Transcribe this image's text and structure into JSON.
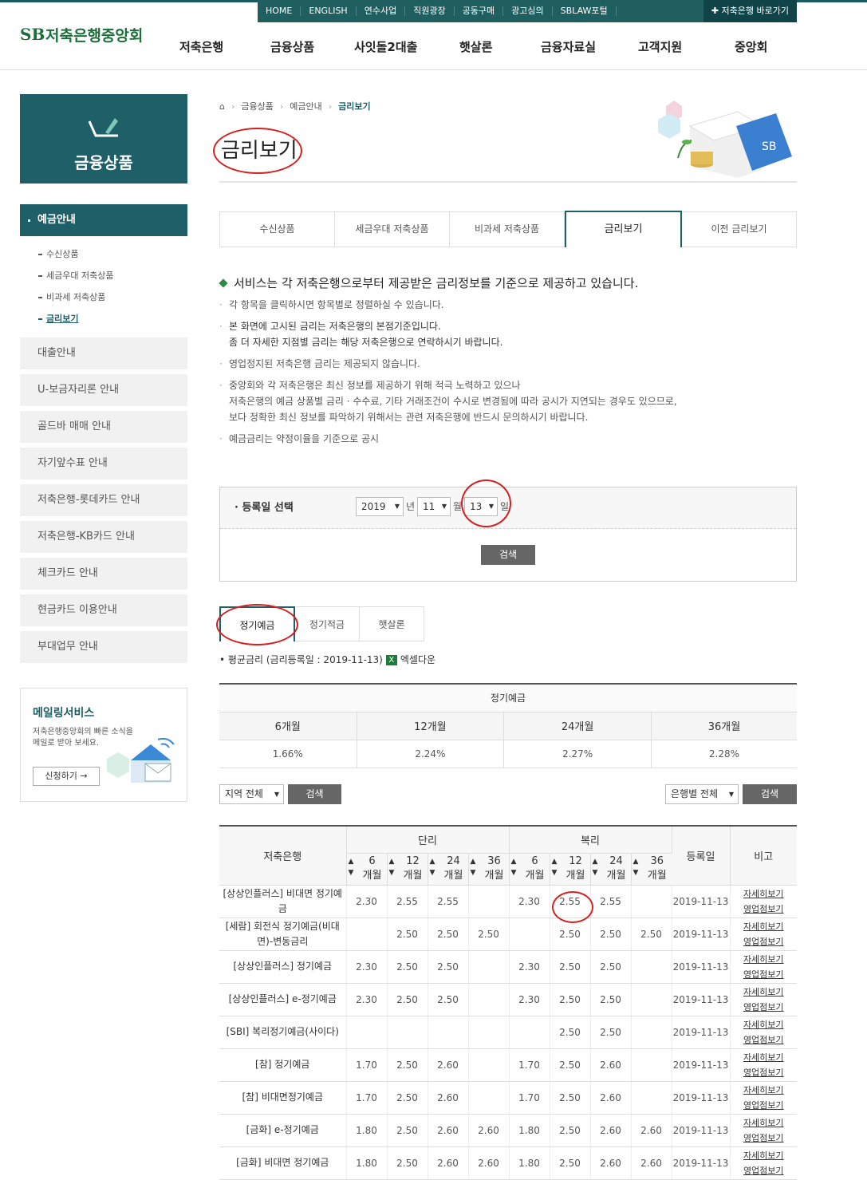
{
  "util": [
    "HOME",
    "ENGLISH",
    "연수사업",
    "직원광장",
    "공동구매",
    "광고심의",
    "SBLAW포털",
    "✚ 저축은행 바로가기"
  ],
  "logo": {
    "mark": "SB",
    "text": "저축은행중앙회"
  },
  "gnb": [
    "저축은행",
    "금융상품",
    "사잇돌2대출",
    "햇살론",
    "금융자료실",
    "고객지원",
    "중앙회"
  ],
  "lnb": {
    "title": "금융상품",
    "active": "예금안내",
    "subs": [
      "수신상품",
      "세금우대 저축상품",
      "비과세 저축상품",
      "금리보기"
    ],
    "items": [
      "대출안내",
      "U-보금자리론 안내",
      "골드바 매매 안내",
      "자기앞수표 안내",
      "저축은행-롯데카드 안내",
      "저축은행-KB카드 안내",
      "체크카드 안내",
      "현금카드 이용안내",
      "부대업무 안내"
    ]
  },
  "mail": {
    "title": "메일링서비스",
    "desc": "저축은행중앙회의 빠른 소식을\n메일로 받아 보세요.",
    "btn": "신청하기 →"
  },
  "crumb": [
    "금융상품",
    "예금안내",
    "금리보기"
  ],
  "page_title": "금리보기",
  "tabs": [
    "수신상품",
    "세금우대 저축상품",
    "비과세 저축상품",
    "금리보기",
    "이전 금리보기"
  ],
  "notice": "서비스는 각 저축은행으로부터 제공받은 금리정보를 기준으로 제공하고 있습니다.",
  "bullets": [
    "각 항목을 클릭하시면 항목별로 정렬하실 수 있습니다.",
    "본 화면에 고시된 금리는 저축은행의 본점기준입니다.\n좀 더 자세한 지점별 금리는 해당 저축은행으로 연락하시기 바랍니다.",
    "영업정지된 저축은행 금리는 제공되지 않습니다.",
    "중앙회와 각 저축은행은 최신 정보를 제공하기 위해 적극 노력하고 있으나\n저축은행의 예금 상품별 금리 · 수수료, 기타 거래조건이 수시로 변경됨에 따라 공시가 지연되는 경우도 있으므로,\n보다 정확한 최신 정보를 파악하기 위해서는 관련 저축은행에 반드시 문의하시기 바랍니다.",
    "예금금리는 약정이율을 기준으로 공시"
  ],
  "reg": {
    "label": "등록일 선택",
    "year": "2019",
    "month": "11",
    "day": "13",
    "u_year": "년",
    "u_month": "월",
    "u_day": "일",
    "search": "검색"
  },
  "subtabs": [
    "정기예금",
    "정기적금",
    "햇살론"
  ],
  "avg": {
    "text": "평균금리 (금리등록일 : 2019-11-13)",
    "excel": "엑셀다운",
    "head": "정기예금",
    "cols": [
      "6개월",
      "12개월",
      "24개월",
      "36개월"
    ],
    "vals": [
      "1.66%",
      "2.24%",
      "2.27%",
      "2.28%"
    ]
  },
  "filters": {
    "region": "지역 전체",
    "bank": "은행별 전체",
    "search": "검색"
  },
  "table": {
    "h_bank": "저축은행",
    "h_simple": "단리",
    "h_comp": "복리",
    "h_date": "등록일",
    "h_note": "비고",
    "periods": [
      "6",
      "12",
      "24",
      "36"
    ],
    "unit": "개월",
    "sort_up": "▲",
    "sort_down": "▼",
    "link1": "자세히보기",
    "link2": "영업점보기",
    "rows": [
      {
        "name": "[상상인플러스] 비대면 정기예금",
        "v": [
          "2.30",
          "2.55",
          "2.55",
          "",
          "2.30",
          "2.55",
          "2.55",
          ""
        ],
        "date": "2019-11-13"
      },
      {
        "name": "[세람] 회전식 정기예금(비대면)-변동금리",
        "v": [
          "",
          "2.50",
          "2.50",
          "2.50",
          "",
          "2.50",
          "2.50",
          "2.50"
        ],
        "date": "2019-11-13"
      },
      {
        "name": "[상상인플러스] 정기예금",
        "v": [
          "2.30",
          "2.50",
          "2.50",
          "",
          "2.30",
          "2.50",
          "2.50",
          ""
        ],
        "date": "2019-11-13"
      },
      {
        "name": "[상상인플러스] e-정기예금",
        "v": [
          "2.30",
          "2.50",
          "2.50",
          "",
          "2.30",
          "2.50",
          "2.50",
          ""
        ],
        "date": "2019-11-13"
      },
      {
        "name": "[SBI] 복리정기예금(사이다)",
        "v": [
          "",
          "",
          "",
          "",
          "",
          "2.50",
          "2.50",
          ""
        ],
        "date": "2019-11-13"
      },
      {
        "name": "[참] 정기예금",
        "v": [
          "1.70",
          "2.50",
          "2.60",
          "",
          "1.70",
          "2.50",
          "2.60",
          ""
        ],
        "date": "2019-11-13"
      },
      {
        "name": "[참] 비대면정기예금",
        "v": [
          "1.70",
          "2.50",
          "2.60",
          "",
          "1.70",
          "2.50",
          "2.60",
          ""
        ],
        "date": "2019-11-13"
      },
      {
        "name": "[금화] e-정기예금",
        "v": [
          "1.80",
          "2.50",
          "2.60",
          "2.60",
          "1.80",
          "2.50",
          "2.60",
          "2.60"
        ],
        "date": "2019-11-13"
      },
      {
        "name": "[금화] 비대면 정기예금",
        "v": [
          "1.80",
          "2.50",
          "2.60",
          "2.60",
          "1.80",
          "2.50",
          "2.60",
          "2.60"
        ],
        "date": "2019-11-13"
      }
    ]
  },
  "colors": {
    "brand": "#1f5f68",
    "logo": "#1c6f3a",
    "annot": "#d61f1f"
  }
}
